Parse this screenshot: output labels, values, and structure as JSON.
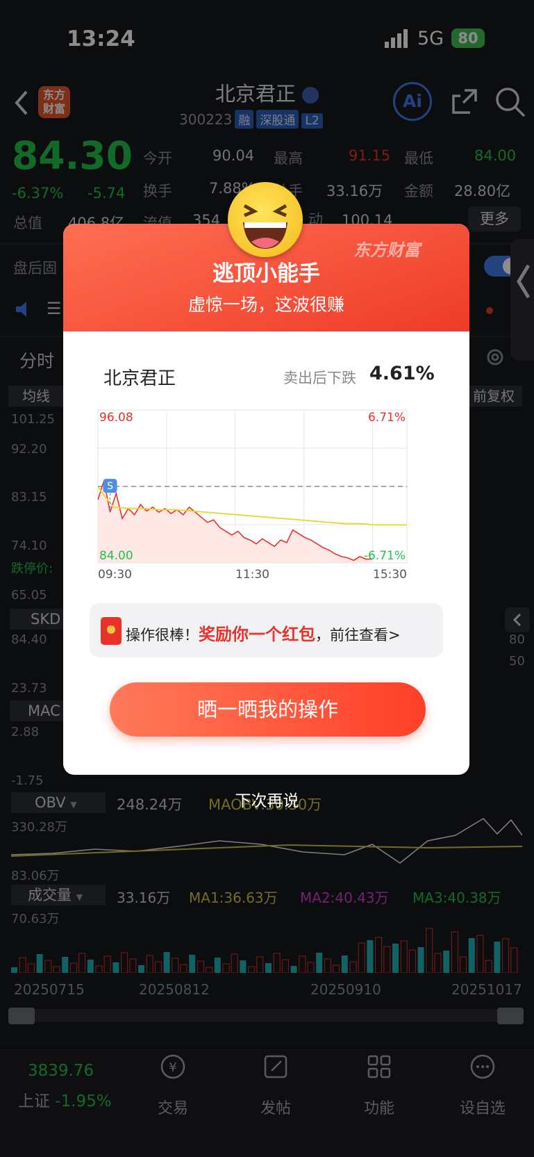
{
  "status": {
    "time": "13:24",
    "network": "5G",
    "battery": "80"
  },
  "header": {
    "name": "北京君正",
    "code": "300223",
    "tags": [
      "融",
      "深股通",
      "L2"
    ],
    "logo": "东方财富",
    "ai": "Ai"
  },
  "quote": {
    "price": "84.30",
    "pct": "-6.37%",
    "chg": "-5.74",
    "open_l": "今开",
    "open": "90.04",
    "high_l": "最高",
    "high": "91.15",
    "low_l": "最低",
    "low": "84.00",
    "turn_l": "换手",
    "turn": "7.88%",
    "vol_l": "总手",
    "vol": "33.16万",
    "amt_l": "金额",
    "amt": "28.80亿",
    "mv_l": "总值",
    "mv": "406.8亿",
    "flow_l": "流值",
    "flow": "354",
    "act_l": "动",
    "act": "100.14",
    "more": "更多"
  },
  "behind": {
    "after": "盘后固",
    "tab": "分时",
    "ma": "均线",
    "fq": "前复权",
    "p1": "101.25",
    "p2": "92.20",
    "p3": "83.15",
    "p4": "74.10",
    "limit": "跌停价:",
    "p5": "65.05",
    "skd": "SKD",
    "skd1": "84.40",
    "skd2": "23.73",
    "skd_r1": "80",
    "skd_r2": "50",
    "mac": "MAC",
    "mac1": "2.88",
    "mac2": "-1.75",
    "obv": "OBV",
    "obv_v": "248.24万",
    "obv_ma": "MAOBV:30.30万",
    "obv1": "330.28万",
    "obv2": "83.06万",
    "vol": "成交量",
    "vol_v": "33.16万",
    "ma1": "MA1:36.63万",
    "ma2": "MA2:40.43万",
    "ma3": "MA3:40.38万",
    "vol1": "70.63万",
    "dates": [
      "20250715",
      "20250812",
      "20250910",
      "20251017"
    ]
  },
  "modal": {
    "brand": "东方财富",
    "title": "逃顶小能手",
    "subtitle": "虚惊一场，这波很赚",
    "stock": "北京君正",
    "drop_label": "卖出后下跌",
    "drop": "4.61%",
    "reward_pre": "操作很棒！",
    "reward_mid": "奖励你一个红包",
    "reward_post": "，前往查看>",
    "share": "晒一晒我的操作",
    "later": "下次再说"
  },
  "chart_data": {
    "type": "line",
    "title": "",
    "x_ticks": [
      "09:30",
      "11:30",
      "15:30"
    ],
    "y_top": "96.08",
    "y_bottom": "84.00",
    "pct_top": "6.71%",
    "pct_bottom": "-6.71%",
    "ref_price": "90.04",
    "sell_marker": "S",
    "series": [
      {
        "values": [
          89.0,
          90.5,
          88.0,
          89.5,
          87.5,
          88.3,
          87.8,
          88.6,
          88.1,
          88.4,
          88.0,
          88.3,
          87.9,
          88.2,
          87.8,
          88.4,
          88.0,
          87.6,
          87.2,
          87.4,
          86.8,
          86.5,
          86.2,
          86.5,
          86.0,
          85.8,
          85.5,
          85.9,
          85.6,
          85.3,
          85.8,
          85.6,
          86.6,
          86.3,
          86.0,
          85.8,
          85.5,
          85.2,
          85.0,
          84.7,
          84.5,
          84.4,
          84.2,
          84.5,
          84.3,
          84.3
        ]
      },
      {
        "values": [
          90.0,
          88.4,
          88.3,
          88.3,
          88.2,
          88.2,
          88.1,
          88.0,
          87.9,
          87.8,
          87.7,
          87.6,
          87.5,
          87.4,
          87.3,
          87.2,
          87.1,
          87.1,
          87.0,
          87.0,
          87.0
        ]
      }
    ]
  },
  "nav": {
    "index": "3839.76",
    "index_name": "上证",
    "index_pct": "-1.95%",
    "items": [
      "交易",
      "发帖",
      "功能",
      "设自选"
    ]
  }
}
